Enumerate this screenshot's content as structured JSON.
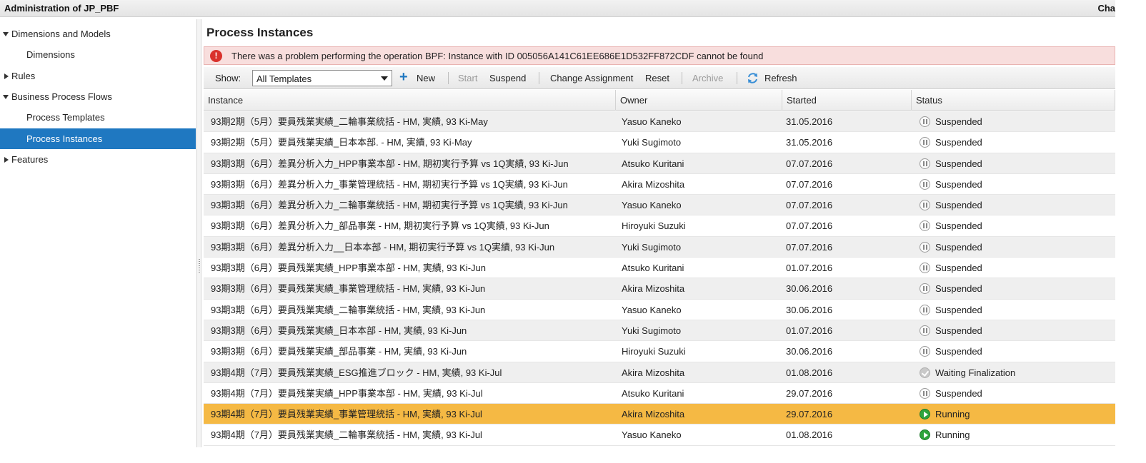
{
  "window": {
    "title": "Administration of JP_PBF",
    "right_label": "Cha"
  },
  "sidebar": {
    "items": [
      {
        "label": "Dimensions and Models",
        "expanded": "down"
      },
      {
        "label": "Dimensions"
      },
      {
        "label": "Rules",
        "expanded": "right"
      },
      {
        "label": "Business Process Flows",
        "expanded": "down"
      },
      {
        "label": "Process Templates"
      },
      {
        "label": "Process Instances",
        "selected": true
      },
      {
        "label": "Features",
        "expanded": "right"
      }
    ]
  },
  "main": {
    "title": "Process Instances",
    "error": {
      "icon": "error-icon",
      "symbol": "!",
      "message": "There was a problem performing the operation BPF: Instance with ID 005056A141C61EE686E1D532FF872CDF cannot be found"
    },
    "toolbar": {
      "show_label": "Show:",
      "template_select": "All Templates",
      "new": "New",
      "start": "Start",
      "suspend": "Suspend",
      "change_assignment": "Change Assignment",
      "reset": "Reset",
      "archive": "Archive",
      "refresh": "Refresh"
    },
    "table": {
      "columns": [
        "Instance",
        "Owner",
        "Started",
        "Status"
      ],
      "rows": [
        {
          "instance": "93期2期（5月）要員残業実績_二輪事業統括 - HM, 実績, 93 Ki-May",
          "owner": "Yasuo Kaneko",
          "started": "31.05.2016",
          "status": "Suspended",
          "state": "suspended"
        },
        {
          "instance": "93期2期（5月）要員残業実績_日本本部. - HM, 実績, 93 Ki-May",
          "owner": "Yuki Sugimoto",
          "started": "31.05.2016",
          "status": "Suspended",
          "state": "suspended"
        },
        {
          "instance": "93期3期（6月）差異分析入力_HPP事業本部 - HM, 期初実行予算 vs 1Q実績, 93 Ki-Jun",
          "owner": "Atsuko Kuritani",
          "started": "07.07.2016",
          "status": "Suspended",
          "state": "suspended"
        },
        {
          "instance": "93期3期（6月）差異分析入力_事業管理統括 - HM, 期初実行予算 vs 1Q実績, 93 Ki-Jun",
          "owner": "Akira Mizoshita",
          "started": "07.07.2016",
          "status": "Suspended",
          "state": "suspended"
        },
        {
          "instance": "93期3期（6月）差異分析入力_二輪事業統括 - HM, 期初実行予算 vs 1Q実績, 93 Ki-Jun",
          "owner": "Yasuo Kaneko",
          "started": "07.07.2016",
          "status": "Suspended",
          "state": "suspended"
        },
        {
          "instance": "93期3期（6月）差異分析入力_部品事業 - HM, 期初実行予算 vs 1Q実績, 93 Ki-Jun",
          "owner": "Hiroyuki Suzuki",
          "started": "07.07.2016",
          "status": "Suspended",
          "state": "suspended"
        },
        {
          "instance": "93期3期（6月）差異分析入力__日本本部 - HM, 期初実行予算 vs 1Q実績, 93 Ki-Jun",
          "owner": "Yuki Sugimoto",
          "started": "07.07.2016",
          "status": "Suspended",
          "state": "suspended"
        },
        {
          "instance": "93期3期（6月）要員残業実績_HPP事業本部 - HM, 実績, 93 Ki-Jun",
          "owner": "Atsuko Kuritani",
          "started": "01.07.2016",
          "status": "Suspended",
          "state": "suspended"
        },
        {
          "instance": "93期3期（6月）要員残業実績_事業管理統括 - HM, 実績, 93 Ki-Jun",
          "owner": "Akira Mizoshita",
          "started": "30.06.2016",
          "status": "Suspended",
          "state": "suspended"
        },
        {
          "instance": "93期3期（6月）要員残業実績_二輪事業統括 - HM, 実績, 93 Ki-Jun",
          "owner": "Yasuo Kaneko",
          "started": "30.06.2016",
          "status": "Suspended",
          "state": "suspended"
        },
        {
          "instance": "93期3期（6月）要員残業実績_日本本部 - HM, 実績, 93 Ki-Jun",
          "owner": "Yuki Sugimoto",
          "started": "01.07.2016",
          "status": "Suspended",
          "state": "suspended"
        },
        {
          "instance": "93期3期（6月）要員残業実績_部品事業 - HM, 実績, 93 Ki-Jun",
          "owner": "Hiroyuki Suzuki",
          "started": "30.06.2016",
          "status": "Suspended",
          "state": "suspended"
        },
        {
          "instance": "93期4期（7月）要員残業実績_ESG推進ブロック - HM, 実績, 93 Ki-Jul",
          "owner": "Akira Mizoshita",
          "started": "01.08.2016",
          "status": "Waiting Finalization",
          "state": "waiting"
        },
        {
          "instance": "93期4期（7月）要員残業実績_HPP事業本部 - HM, 実績, 93 Ki-Jul",
          "owner": "Atsuko Kuritani",
          "started": "29.07.2016",
          "status": "Suspended",
          "state": "suspended"
        },
        {
          "instance": "93期4期（7月）要員残業実績_事業管理統括 - HM, 実績, 93 Ki-Jul",
          "owner": "Akira Mizoshita",
          "started": "29.07.2016",
          "status": "Running",
          "state": "running",
          "selected": true
        },
        {
          "instance": "93期4期（7月）要員残業実績_二輪事業統括 - HM, 実績, 93 Ki-Jul",
          "owner": "Yasuo Kaneko",
          "started": "01.08.2016",
          "status": "Running",
          "state": "running"
        }
      ]
    }
  },
  "colors": {
    "selection": "#1f78c1",
    "selected_row": "#f5b944",
    "error_bg": "#f8dedd",
    "error_icon": "#d9312b",
    "running": "#2ea43c"
  }
}
